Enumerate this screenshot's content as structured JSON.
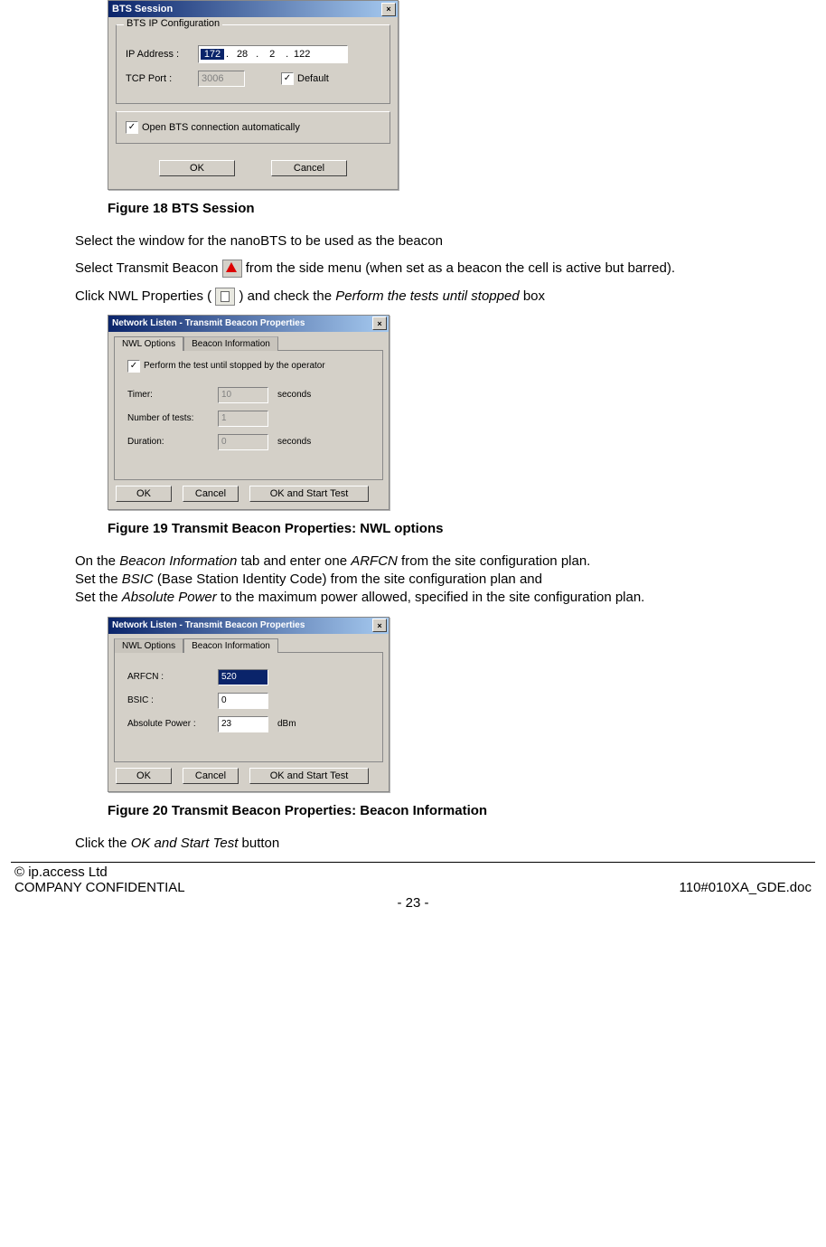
{
  "dialog1": {
    "title": "BTS Session",
    "group_legend": "BTS IP Configuration",
    "ip_label": "IP Address :",
    "ip_oct1": "172",
    "ip_oct2": "28",
    "ip_oct3": "2",
    "ip_oct4": "122",
    "tcp_label": "TCP Port :",
    "tcp_value": "3006",
    "default_label": "Default",
    "open_label": "Open BTS connection automatically",
    "ok": "OK",
    "cancel": "Cancel"
  },
  "fig18": "Figure 18 BTS Session",
  "para1": "Select the window for the nanoBTS to be used as the beacon",
  "para2a": "Select Transmit Beacon ",
  "para2b": " from the side menu (when set as a beacon the cell is active but barred).",
  "para3a": "Click NWL Properties (",
  "para3b": ") and check the ",
  "para3c": "Perform the tests until stopped",
  "para3d": " box",
  "dialog2": {
    "title": "Network Listen - Transmit Beacon Properties",
    "tab1": "NWL Options",
    "tab2": "Beacon Information",
    "perform_label": "Perform the test until stopped by the operator",
    "timer_label": "Timer:",
    "timer_val": "10",
    "timer_unit": "seconds",
    "ntests_label": "Number of tests:",
    "ntests_val": "1",
    "duration_label": "Duration:",
    "duration_val": "0",
    "duration_unit": "seconds",
    "ok": "OK",
    "cancel": "Cancel",
    "okstart": "OK  and  Start Test"
  },
  "fig19": "Figure 19 Transmit Beacon Properties: NWL options",
  "para4_1a": "On the ",
  "para4_1b": "Beacon Information",
  "para4_1c": " tab and enter one ",
  "para4_1d": "ARFCN",
  "para4_1e": " from the site configuration plan.",
  "para4_2a": "Set the ",
  "para4_2b": "BSIC",
  "para4_2c": " (Base Station Identity Code) from the site configuration plan and",
  "para4_3a": "Set the ",
  "para4_3b": "Absolute Power",
  "para4_3c": " to the maximum power allowed, specified in the site configuration plan.",
  "dialog3": {
    "title": "Network Listen - Transmit Beacon Properties",
    "tab1": "NWL Options",
    "tab2": "Beacon Information",
    "arfcn_label": "ARFCN :",
    "arfcn_val": "520",
    "bsic_label": "BSIC :",
    "bsic_val": "0",
    "ap_label": "Absolute Power :",
    "ap_val": "23",
    "ap_unit": "dBm",
    "ok": "OK",
    "cancel": "Cancel",
    "okstart": "OK  and  Start Test"
  },
  "fig20": "Figure 20 Transmit Beacon Properties: Beacon Information",
  "para5a": "Click the ",
  "para5b": "OK and Start Test",
  "para5c": " button",
  "footer": {
    "copyright": "© ip.access Ltd",
    "conf": "COMPANY CONFIDENTIAL",
    "doc": "110#010XA_GDE.doc",
    "page": "- 23 -"
  }
}
